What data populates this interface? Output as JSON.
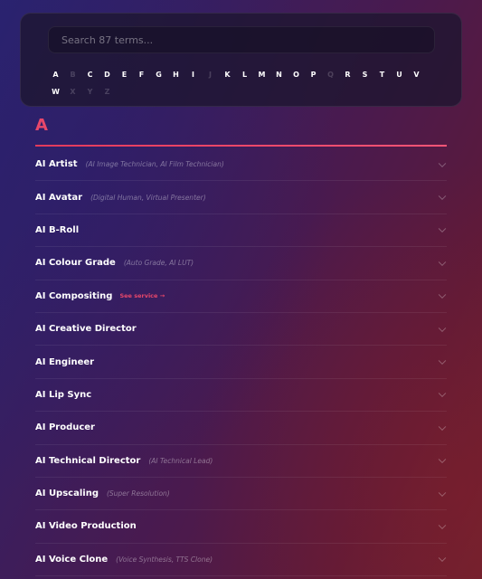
{
  "search": {
    "placeholder": "Search 87 terms..."
  },
  "alphabet": [
    {
      "letter": "A",
      "enabled": true
    },
    {
      "letter": "B",
      "enabled": false
    },
    {
      "letter": "C",
      "enabled": true
    },
    {
      "letter": "D",
      "enabled": true
    },
    {
      "letter": "E",
      "enabled": true
    },
    {
      "letter": "F",
      "enabled": true
    },
    {
      "letter": "G",
      "enabled": true
    },
    {
      "letter": "H",
      "enabled": true
    },
    {
      "letter": "I",
      "enabled": true
    },
    {
      "letter": "J",
      "enabled": false
    },
    {
      "letter": "K",
      "enabled": true
    },
    {
      "letter": "L",
      "enabled": true
    },
    {
      "letter": "M",
      "enabled": true
    },
    {
      "letter": "N",
      "enabled": true
    },
    {
      "letter": "O",
      "enabled": true
    },
    {
      "letter": "P",
      "enabled": true
    },
    {
      "letter": "Q",
      "enabled": false
    },
    {
      "letter": "R",
      "enabled": true
    },
    {
      "letter": "S",
      "enabled": true
    },
    {
      "letter": "T",
      "enabled": true
    },
    {
      "letter": "U",
      "enabled": true
    },
    {
      "letter": "V",
      "enabled": true
    },
    {
      "letter": "W",
      "enabled": true
    },
    {
      "letter": "X",
      "enabled": false
    },
    {
      "letter": "Y",
      "enabled": false
    },
    {
      "letter": "Z",
      "enabled": false
    }
  ],
  "section": {
    "letter": "A"
  },
  "terms": [
    {
      "name": "AI Artist",
      "aka": "(AI Image Technician, AI Film Technician)",
      "link": ""
    },
    {
      "name": "AI Avatar",
      "aka": "(Digital Human, Virtual Presenter)",
      "link": ""
    },
    {
      "name": "AI B-Roll",
      "aka": "",
      "link": ""
    },
    {
      "name": "AI Colour Grade",
      "aka": "(Auto Grade, AI LUT)",
      "link": ""
    },
    {
      "name": "AI Compositing",
      "aka": "",
      "link": "See service →"
    },
    {
      "name": "AI Creative Director",
      "aka": "",
      "link": ""
    },
    {
      "name": "AI Engineer",
      "aka": "",
      "link": ""
    },
    {
      "name": "AI Lip Sync",
      "aka": "",
      "link": ""
    },
    {
      "name": "AI Producer",
      "aka": "",
      "link": ""
    },
    {
      "name": "AI Technical Director",
      "aka": "(AI Technical Lead)",
      "link": ""
    },
    {
      "name": "AI Upscaling",
      "aka": "(Super Resolution)",
      "link": ""
    },
    {
      "name": "AI Video Production",
      "aka": "",
      "link": ""
    },
    {
      "name": "AI Voice Clone",
      "aka": "(Voice Synthesis, TTS Clone)",
      "link": ""
    }
  ],
  "colors": {
    "accent": "#e8476a",
    "panel": "#1e1630"
  }
}
